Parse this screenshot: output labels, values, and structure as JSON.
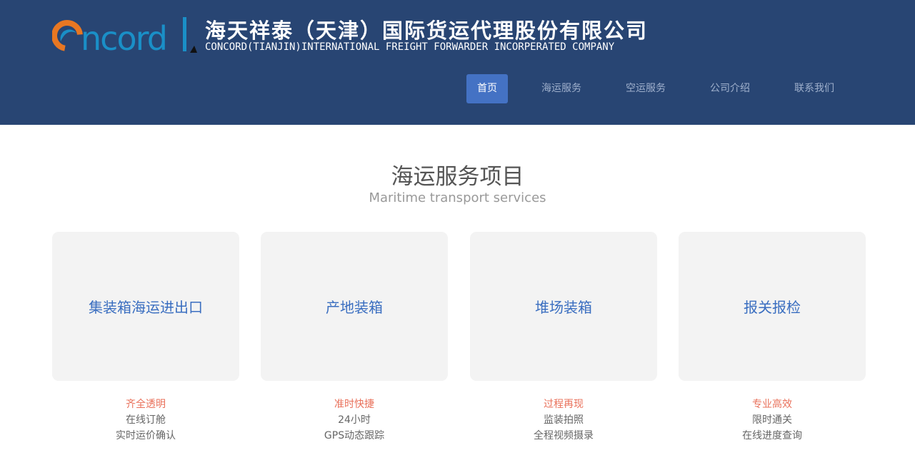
{
  "header": {
    "logo_text": "Concord",
    "company_name_cn": "海天祥泰（天津）国际货运代理股份有限公司",
    "company_name_en": "CONCORD(TIANJIN)INTERNATIONAL FREIGHT FORWARDER INCORPERATED COMPANY"
  },
  "nav": {
    "items": [
      {
        "label": "首页",
        "active": true
      },
      {
        "label": "海运服务",
        "active": false
      },
      {
        "label": "空运服务",
        "active": false
      },
      {
        "label": "公司介绍",
        "active": false
      },
      {
        "label": "联系我们",
        "active": false
      }
    ]
  },
  "section": {
    "title": "海运服务项目",
    "subtitle": "Maritime transport services"
  },
  "services": [
    {
      "title": "集装箱海运进出口",
      "highlight": "齐全透明",
      "line1": "在线订舱",
      "line2": "实时运价确认"
    },
    {
      "title": "产地装箱",
      "highlight": "准时快捷",
      "line1": "24小时",
      "line2": "GPS动态跟踪"
    },
    {
      "title": "堆场装箱",
      "highlight": "过程再现",
      "line1": "监装拍照",
      "line2": "全程视频摄录"
    },
    {
      "title": "报关报检",
      "highlight": "专业高效",
      "line1": "限时通关",
      "line2": "在线进度查询"
    }
  ],
  "colors": {
    "header_bg": "#284573",
    "nav_active_bg": "#4472c4",
    "card_title": "#3a6ec0",
    "highlight": "#e9705a",
    "logo_orange": "#e87722",
    "logo_blue": "#1a8fc7"
  }
}
